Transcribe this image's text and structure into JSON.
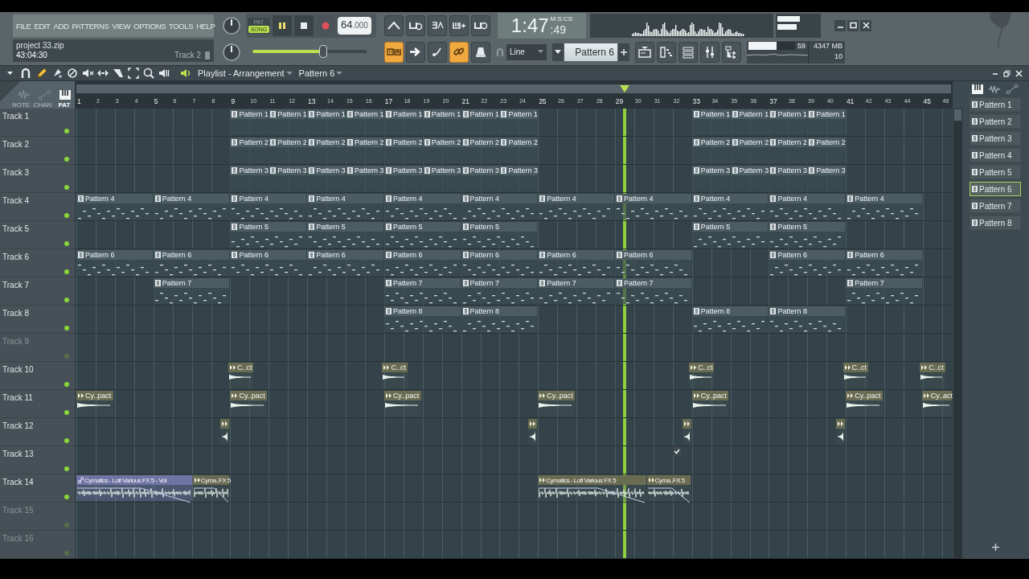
{
  "menu": [
    "FILE",
    "EDIT",
    "ADD",
    "PATTERNS",
    "VIEW",
    "OPTIONS",
    "TOOLS",
    "HELP"
  ],
  "modes": [
    {
      "label": "PAT",
      "selected": false
    },
    {
      "label": "SONG",
      "selected": true
    }
  ],
  "tempo": "64",
  "tempo_fraction": ".000",
  "time": {
    "main": "1:47",
    "fraction": ":49",
    "format": "M:S:CS"
  },
  "project": {
    "file": "project 33.zip",
    "elapsed": "43:04:30",
    "hint": "Track 2"
  },
  "master": {
    "level": 0.62
  },
  "tool_buttons": [
    {
      "on": true
    },
    {
      "on": false
    },
    {
      "on": false
    },
    {
      "on": true
    },
    {
      "on": false
    }
  ],
  "snap": "Line",
  "pattern_selector": "Pattern 6",
  "cpu": {
    "level": 0.6,
    "value": "59",
    "memory": "4347 MB",
    "polyphony": "10"
  },
  "playlist": {
    "title": "Playlist - Arrangement",
    "pattern": "Pattern 6",
    "views": [
      {
        "label": "NOTE",
        "selected": false
      },
      {
        "label": "CHAN",
        "selected": false
      },
      {
        "label": "PAT",
        "selected": true
      }
    ],
    "ruler": [
      "1",
      "2",
      "3",
      "4",
      "5",
      "6",
      "7",
      "8",
      "9",
      "10",
      "11",
      "12",
      "13",
      "14",
      "15",
      "16",
      "17",
      "18",
      "19",
      "20",
      "21",
      "22",
      "23",
      "24",
      "25",
      "26",
      "27",
      "28",
      "29",
      "30",
      "31",
      "32",
      "33",
      "34",
      "35",
      "36",
      "37",
      "38",
      "39",
      "40",
      "41",
      "42",
      "43",
      "44",
      "45",
      "46"
    ],
    "tracks": [
      {
        "name": "Track 1",
        "muted": false,
        "clips": [
          {
            "kind": "pattern",
            "label": "Pattern 1"
          },
          {
            "kind": "pattern",
            "label": "Pattern 1"
          },
          {
            "kind": "pattern",
            "label": "Pattern 1"
          },
          {
            "kind": "pattern",
            "label": "Pattern 1"
          },
          {
            "kind": "pattern",
            "label": "Pattern 1"
          },
          {
            "kind": "pattern",
            "label": "Pattern 1"
          },
          {
            "kind": "pattern",
            "label": "Pattern 1"
          },
          {
            "kind": "pattern",
            "label": "Pattern 1"
          },
          {
            "kind": "pattern",
            "label": "Pattern 1"
          },
          {
            "kind": "pattern",
            "label": "Pattern 1"
          },
          {
            "kind": "pattern",
            "label": "Pattern 1"
          },
          {
            "kind": "pattern",
            "label": "Pattern 1"
          }
        ]
      },
      {
        "name": "Track 2",
        "muted": false,
        "clips": [
          {
            "kind": "pattern",
            "label": "Pattern 2"
          },
          {
            "kind": "pattern",
            "label": "Pattern 2"
          },
          {
            "kind": "pattern",
            "label": "Pattern 2"
          },
          {
            "kind": "pattern",
            "label": "Pattern 2"
          },
          {
            "kind": "pattern",
            "label": "Pattern 2"
          },
          {
            "kind": "pattern",
            "label": "Pattern 2"
          },
          {
            "kind": "pattern",
            "label": "Pattern 2"
          },
          {
            "kind": "pattern",
            "label": "Pattern 2"
          },
          {
            "kind": "pattern",
            "label": "Pattern 2"
          },
          {
            "kind": "pattern",
            "label": "Pattern 2"
          },
          {
            "kind": "pattern",
            "label": "Pattern 2"
          },
          {
            "kind": "pattern",
            "label": "Pattern 2"
          }
        ]
      },
      {
        "name": "Track 3",
        "muted": false,
        "clips": [
          {
            "kind": "pattern",
            "label": "Pattern 3"
          },
          {
            "kind": "pattern",
            "label": "Pattern 3"
          },
          {
            "kind": "pattern",
            "label": "Pattern 3"
          },
          {
            "kind": "pattern",
            "label": "Pattern 3"
          },
          {
            "kind": "pattern",
            "label": "Pattern 3"
          },
          {
            "kind": "pattern",
            "label": "Pattern 3"
          },
          {
            "kind": "pattern",
            "label": "Pattern 3"
          },
          {
            "kind": "pattern",
            "label": "Pattern 3"
          },
          {
            "kind": "pattern",
            "label": "Pattern 3"
          },
          {
            "kind": "pattern",
            "label": "Pattern 3"
          },
          {
            "kind": "pattern",
            "label": "Pattern 3"
          },
          {
            "kind": "pattern",
            "label": "Pattern 3"
          }
        ]
      },
      {
        "name": "Track 4",
        "muted": false,
        "clips": [
          {
            "kind": "pattern-notes",
            "label": "Pattern 4"
          },
          {
            "kind": "pattern-notes",
            "label": "Pattern 4"
          },
          {
            "kind": "pattern-notes",
            "label": "Pattern 4"
          },
          {
            "kind": "pattern-notes",
            "label": "Pattern 4"
          },
          {
            "kind": "pattern-notes",
            "label": "Pattern 4"
          },
          {
            "kind": "pattern-notes",
            "label": "Pattern 4"
          },
          {
            "kind": "pattern-notes",
            "label": "Pattern 4"
          },
          {
            "kind": "pattern-notes",
            "label": "Pattern 4"
          },
          {
            "kind": "pattern-notes",
            "label": "Pattern 4"
          },
          {
            "kind": "pattern-notes",
            "label": "Pattern 4"
          },
          {
            "kind": "pattern-notes",
            "label": "Pattern 4"
          }
        ]
      },
      {
        "name": "Track 5",
        "muted": false,
        "clips": [
          {
            "kind": "pattern-notes",
            "label": "Pattern 5"
          },
          {
            "kind": "pattern-notes",
            "label": "Pattern 5"
          },
          {
            "kind": "pattern-notes",
            "label": "Pattern 5"
          },
          {
            "kind": "pattern-notes",
            "label": "Pattern 5"
          },
          {
            "kind": "pattern-notes",
            "label": "Pattern 5"
          },
          {
            "kind": "pattern-notes",
            "label": "Pattern 5"
          }
        ]
      },
      {
        "name": "Track 6",
        "muted": false,
        "clips": [
          {
            "kind": "pattern-notes",
            "label": "Pattern 6"
          },
          {
            "kind": "pattern-notes",
            "label": "Pattern 6"
          },
          {
            "kind": "pattern-notes",
            "label": "Pattern 6"
          },
          {
            "kind": "pattern-notes",
            "label": "Pattern 6"
          },
          {
            "kind": "pattern-notes",
            "label": "Pattern 6"
          },
          {
            "kind": "pattern-notes",
            "label": "Pattern 6"
          },
          {
            "kind": "pattern-notes",
            "label": "Pattern 6"
          },
          {
            "kind": "pattern-notes",
            "label": "Pattern 6"
          },
          {
            "kind": "pattern-notes",
            "label": "Pattern 6"
          },
          {
            "kind": "pattern-notes",
            "label": "Pattern 6"
          }
        ]
      },
      {
        "name": "Track 7",
        "muted": false,
        "clips": [
          {
            "kind": "pattern-notes",
            "label": "Pattern 7"
          },
          {
            "kind": "pattern-notes",
            "label": "Pattern 7"
          },
          {
            "kind": "pattern-notes",
            "label": "Pattern 7"
          },
          {
            "kind": "pattern-notes",
            "label": "Pattern 7"
          },
          {
            "kind": "pattern-notes",
            "label": "Pattern 7"
          },
          {
            "kind": "pattern-notes",
            "label": "Pattern 7"
          }
        ]
      },
      {
        "name": "Track 8",
        "muted": false,
        "clips": [
          {
            "kind": "pattern-notes",
            "label": "Pattern 8"
          },
          {
            "kind": "pattern-notes",
            "label": "Pattern 8"
          },
          {
            "kind": "pattern-notes",
            "label": "Pattern 8"
          },
          {
            "kind": "pattern-notes",
            "label": "Pattern 8"
          }
        ]
      },
      {
        "name": "Track 9",
        "muted": true
      },
      {
        "name": "Track 10",
        "muted": false,
        "clips": [
          {
            "kind": "audio",
            "label": "C..ct"
          },
          {
            "kind": "audio",
            "label": "C..ct"
          },
          {
            "kind": "audio",
            "label": "C..ct"
          },
          {
            "kind": "audio",
            "label": "C..ct"
          },
          {
            "kind": "audio",
            "label": "C..ct"
          }
        ]
      },
      {
        "name": "Track 11",
        "muted": false,
        "clips": [
          {
            "kind": "audio",
            "label": "Cy..pact"
          },
          {
            "kind": "audio",
            "label": "Cy..pact"
          },
          {
            "kind": "audio",
            "label": "Cy..pact"
          },
          {
            "kind": "audio",
            "label": "Cy..pact"
          },
          {
            "kind": "audio",
            "label": "Cy..pact"
          },
          {
            "kind": "audio",
            "label": "Cy..pact"
          },
          {
            "kind": "audio",
            "label": "Cy..act"
          }
        ]
      },
      {
        "name": "Track 12",
        "muted": false,
        "clips": [
          {
            "kind": "audio-short"
          },
          {
            "kind": "audio-short"
          },
          {
            "kind": "audio-short"
          },
          {
            "kind": "audio-short"
          }
        ]
      },
      {
        "name": "Track 13",
        "muted": false,
        "clips": [
          {
            "kind": "marker"
          }
        ]
      },
      {
        "name": "Track 14",
        "muted": false,
        "clips": [
          {
            "kind": "audio-linked",
            "label": "Cymatics - Lofi Various FX 5 - Vol"
          },
          {
            "kind": "audio-long",
            "label": "Cyma..FX 5"
          },
          {
            "kind": "audio-long",
            "label": "Cymatics - Lofi Various FX 5"
          },
          {
            "kind": "audio-long",
            "label": "Cyma..FX 5"
          }
        ]
      },
      {
        "name": "Track 15",
        "muted": true
      },
      {
        "name": "Track 16",
        "muted": true
      }
    ]
  },
  "picker": [
    {
      "label": "Pattern 1",
      "selected": false
    },
    {
      "label": "Pattern 2",
      "selected": false
    },
    {
      "label": "Pattern 3",
      "selected": false
    },
    {
      "label": "Pattern 4",
      "selected": false
    },
    {
      "label": "Pattern 5",
      "selected": false
    },
    {
      "label": "Pattern 6",
      "selected": true
    },
    {
      "label": "Pattern 7",
      "selected": false
    },
    {
      "label": "Pattern 8",
      "selected": false
    }
  ]
}
